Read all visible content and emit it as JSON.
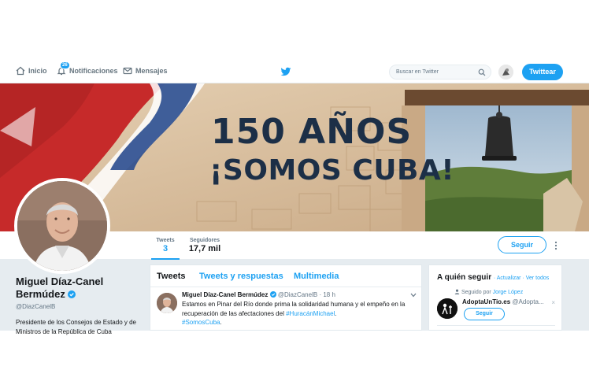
{
  "topnav": {
    "home_label": "Inicio",
    "notifications_label": "Notificaciones",
    "notifications_badge": "26",
    "messages_label": "Mensajes",
    "search_placeholder": "Buscar en Twitter",
    "tweet_button": "Twittear"
  },
  "banner": {
    "line1": "150 AÑOS",
    "line2": "¡SOMOS CUBA!"
  },
  "profile_nav": {
    "tweets_label": "Tweets",
    "tweets_count": "3",
    "followers_label": "Seguidores",
    "followers_count": "17,7 mil",
    "follow_button": "Seguir"
  },
  "profile": {
    "name": "Miguel Díaz-Canel Bermúdez",
    "handle": "@DiazCanelB",
    "bio": "Presidente de los Consejos de Estado y de Ministros de la República de Cuba"
  },
  "timeline": {
    "tabs": [
      "Tweets",
      "Tweets y respuestas",
      "Multimedia"
    ],
    "tweet": {
      "name": "Miguel Díaz-Canel Bermúdez",
      "handle": "@DiazCanelB",
      "time": "· 18 h",
      "text_before": "Estamos en Pinar del Río donde prima la solidaridad humana y el empeño en la recuperación de las afectaciones del ",
      "hashtag1": "#HuracánMichael",
      "text_after": ".",
      "hashtag2": "#SomosCuba",
      "text_end": "."
    }
  },
  "who_to_follow": {
    "title": "A quién seguir",
    "refresh": "Actualizar",
    "view_all": "Ver todos",
    "followed_prefix": "Seguido por",
    "followed_by": "Jorge López",
    "user_name": "AdoptaUnTio.es",
    "user_handle": "@Adopta...",
    "follow_button": "Seguir"
  },
  "colors": {
    "accent": "#1da1f2",
    "banner_text": "#1c2f47",
    "body_bg": "#e6ecf0"
  }
}
